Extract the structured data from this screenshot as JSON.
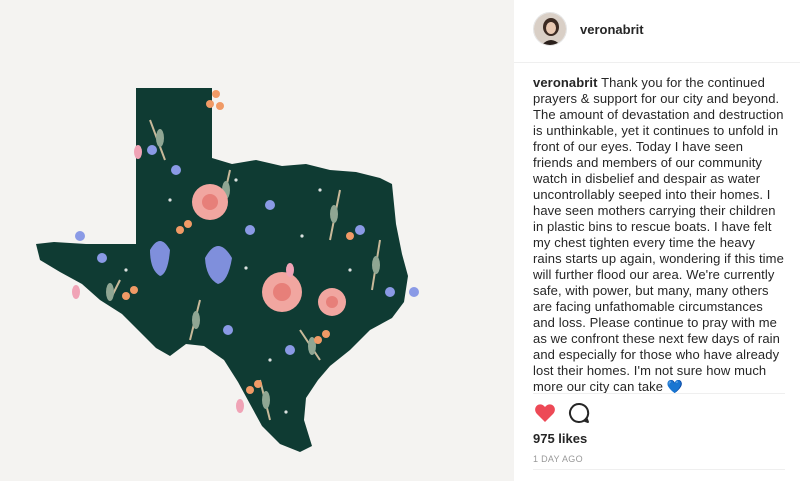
{
  "post": {
    "username": "veronabrit",
    "caption_text": "Thank you for the continued prayers & support for our city and beyond. The amount of devastation and destruction is unthinkable, yet it continues to unfold in front of our eyes. Today I have seen friends and members of our community watch in disbelief and despair as water uncontrollably seeped into their homes. I have seen mothers carrying their children in plastic bins to rescue boats. I have felt my chest tighten every time the heavy rains starts up again, wondering if this time will further flood our area. We're currently safe, with power, but many, many others are facing unfathomable circumstances and loss. Please continue to pray with me as we confront these next few days of rain and especially for those who have already lost their homes. I'm not sure how much more our city can take",
    "caption_emoji": "💙",
    "likes": "975 likes",
    "timestamp": "1 DAY AGO"
  },
  "icons": {
    "like": "heart-icon",
    "comment": "comment-icon"
  },
  "colors": {
    "like_red": "#ed4956",
    "texas_fill": "#0f3b33",
    "text": "#262626",
    "muted": "#999999"
  }
}
